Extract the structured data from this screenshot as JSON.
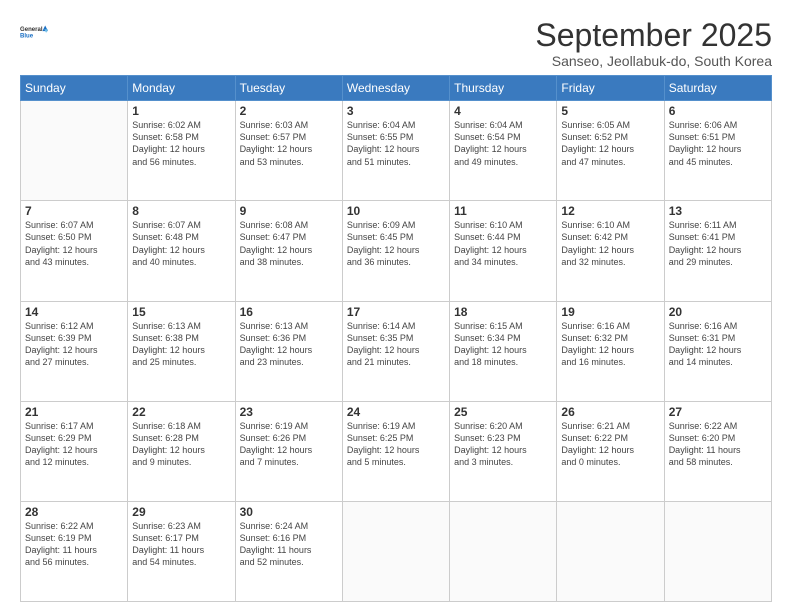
{
  "header": {
    "logo_line1": "General",
    "logo_line2": "Blue",
    "title": "September 2025",
    "subtitle": "Sanseo, Jeollabuk-do, South Korea"
  },
  "days_of_week": [
    "Sunday",
    "Monday",
    "Tuesday",
    "Wednesday",
    "Thursday",
    "Friday",
    "Saturday"
  ],
  "weeks": [
    [
      {
        "day": "",
        "info": ""
      },
      {
        "day": "1",
        "info": "Sunrise: 6:02 AM\nSunset: 6:58 PM\nDaylight: 12 hours\nand 56 minutes."
      },
      {
        "day": "2",
        "info": "Sunrise: 6:03 AM\nSunset: 6:57 PM\nDaylight: 12 hours\nand 53 minutes."
      },
      {
        "day": "3",
        "info": "Sunrise: 6:04 AM\nSunset: 6:55 PM\nDaylight: 12 hours\nand 51 minutes."
      },
      {
        "day": "4",
        "info": "Sunrise: 6:04 AM\nSunset: 6:54 PM\nDaylight: 12 hours\nand 49 minutes."
      },
      {
        "day": "5",
        "info": "Sunrise: 6:05 AM\nSunset: 6:52 PM\nDaylight: 12 hours\nand 47 minutes."
      },
      {
        "day": "6",
        "info": "Sunrise: 6:06 AM\nSunset: 6:51 PM\nDaylight: 12 hours\nand 45 minutes."
      }
    ],
    [
      {
        "day": "7",
        "info": "Sunrise: 6:07 AM\nSunset: 6:50 PM\nDaylight: 12 hours\nand 43 minutes."
      },
      {
        "day": "8",
        "info": "Sunrise: 6:07 AM\nSunset: 6:48 PM\nDaylight: 12 hours\nand 40 minutes."
      },
      {
        "day": "9",
        "info": "Sunrise: 6:08 AM\nSunset: 6:47 PM\nDaylight: 12 hours\nand 38 minutes."
      },
      {
        "day": "10",
        "info": "Sunrise: 6:09 AM\nSunset: 6:45 PM\nDaylight: 12 hours\nand 36 minutes."
      },
      {
        "day": "11",
        "info": "Sunrise: 6:10 AM\nSunset: 6:44 PM\nDaylight: 12 hours\nand 34 minutes."
      },
      {
        "day": "12",
        "info": "Sunrise: 6:10 AM\nSunset: 6:42 PM\nDaylight: 12 hours\nand 32 minutes."
      },
      {
        "day": "13",
        "info": "Sunrise: 6:11 AM\nSunset: 6:41 PM\nDaylight: 12 hours\nand 29 minutes."
      }
    ],
    [
      {
        "day": "14",
        "info": "Sunrise: 6:12 AM\nSunset: 6:39 PM\nDaylight: 12 hours\nand 27 minutes."
      },
      {
        "day": "15",
        "info": "Sunrise: 6:13 AM\nSunset: 6:38 PM\nDaylight: 12 hours\nand 25 minutes."
      },
      {
        "day": "16",
        "info": "Sunrise: 6:13 AM\nSunset: 6:36 PM\nDaylight: 12 hours\nand 23 minutes."
      },
      {
        "day": "17",
        "info": "Sunrise: 6:14 AM\nSunset: 6:35 PM\nDaylight: 12 hours\nand 21 minutes."
      },
      {
        "day": "18",
        "info": "Sunrise: 6:15 AM\nSunset: 6:34 PM\nDaylight: 12 hours\nand 18 minutes."
      },
      {
        "day": "19",
        "info": "Sunrise: 6:16 AM\nSunset: 6:32 PM\nDaylight: 12 hours\nand 16 minutes."
      },
      {
        "day": "20",
        "info": "Sunrise: 6:16 AM\nSunset: 6:31 PM\nDaylight: 12 hours\nand 14 minutes."
      }
    ],
    [
      {
        "day": "21",
        "info": "Sunrise: 6:17 AM\nSunset: 6:29 PM\nDaylight: 12 hours\nand 12 minutes."
      },
      {
        "day": "22",
        "info": "Sunrise: 6:18 AM\nSunset: 6:28 PM\nDaylight: 12 hours\nand 9 minutes."
      },
      {
        "day": "23",
        "info": "Sunrise: 6:19 AM\nSunset: 6:26 PM\nDaylight: 12 hours\nand 7 minutes."
      },
      {
        "day": "24",
        "info": "Sunrise: 6:19 AM\nSunset: 6:25 PM\nDaylight: 12 hours\nand 5 minutes."
      },
      {
        "day": "25",
        "info": "Sunrise: 6:20 AM\nSunset: 6:23 PM\nDaylight: 12 hours\nand 3 minutes."
      },
      {
        "day": "26",
        "info": "Sunrise: 6:21 AM\nSunset: 6:22 PM\nDaylight: 12 hours\nand 0 minutes."
      },
      {
        "day": "27",
        "info": "Sunrise: 6:22 AM\nSunset: 6:20 PM\nDaylight: 11 hours\nand 58 minutes."
      }
    ],
    [
      {
        "day": "28",
        "info": "Sunrise: 6:22 AM\nSunset: 6:19 PM\nDaylight: 11 hours\nand 56 minutes."
      },
      {
        "day": "29",
        "info": "Sunrise: 6:23 AM\nSunset: 6:17 PM\nDaylight: 11 hours\nand 54 minutes."
      },
      {
        "day": "30",
        "info": "Sunrise: 6:24 AM\nSunset: 6:16 PM\nDaylight: 11 hours\nand 52 minutes."
      },
      {
        "day": "",
        "info": ""
      },
      {
        "day": "",
        "info": ""
      },
      {
        "day": "",
        "info": ""
      },
      {
        "day": "",
        "info": ""
      }
    ]
  ]
}
